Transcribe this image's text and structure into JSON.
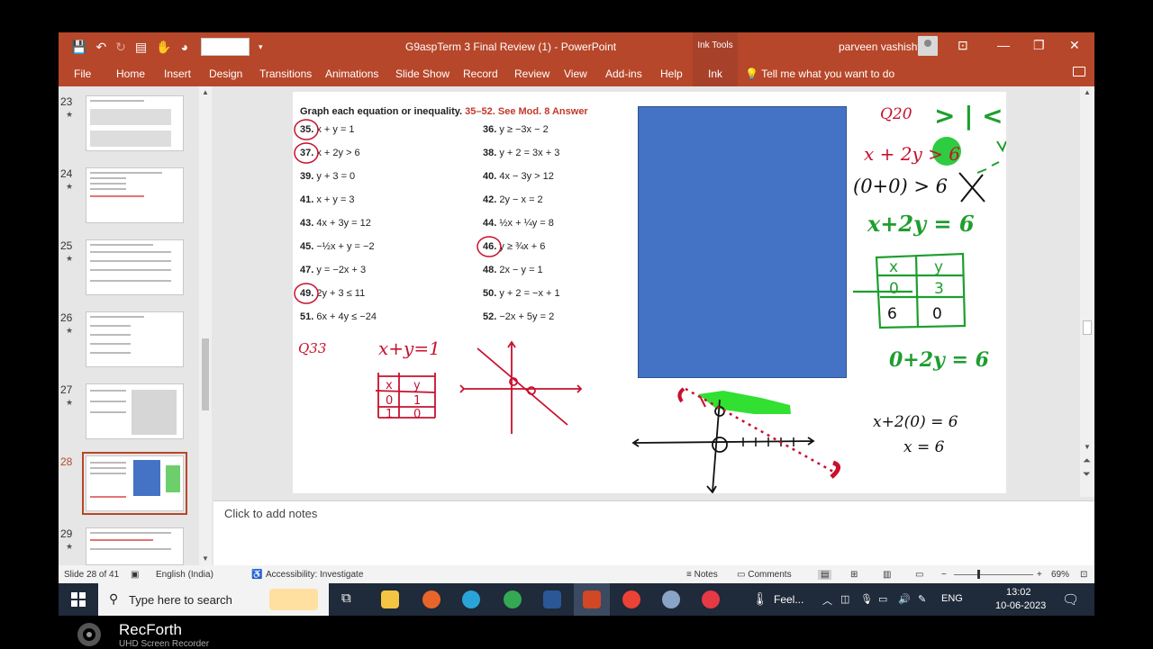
{
  "window": {
    "doc_title": "G9aspTerm 3 Final Review (1)  -  PowerPoint",
    "ink_tools_label": "Ink Tools",
    "user_name": "parveen vashisht",
    "tell_me": "Tell me what you want to do"
  },
  "ribbon": {
    "tabs": [
      "File",
      "Home",
      "Insert",
      "Design",
      "Transitions",
      "Animations",
      "Slide Show",
      "Record",
      "Review",
      "View",
      "Add-ins",
      "Help"
    ],
    "active_tab": "Ink"
  },
  "thumbnails": {
    "numbers": [
      "23",
      "24",
      "25",
      "26",
      "27",
      "28",
      "29"
    ],
    "selected": "28"
  },
  "slide": {
    "heading": "Graph each equation or inequality.",
    "heading_note": "35–52. See Mod. 8 Answer",
    "problems_left": [
      {
        "num": "35.",
        "eq": "x + y = 1"
      },
      {
        "num": "37.",
        "eq": "x + 2y > 6"
      },
      {
        "num": "39.",
        "eq": "y + 3 = 0"
      },
      {
        "num": "41.",
        "eq": "x + y = 3"
      },
      {
        "num": "43.",
        "eq": "4x + 3y = 12"
      },
      {
        "num": "45.",
        "eq": "−½x + y = −2"
      },
      {
        "num": "47.",
        "eq": "y = −2x + 3"
      },
      {
        "num": "49.",
        "eq": "2y + 3 ≤ 11"
      },
      {
        "num": "51.",
        "eq": "6x + 4y ≤ −24"
      }
    ],
    "problems_right": [
      {
        "num": "36.",
        "eq": "y ≥ −3x − 2"
      },
      {
        "num": "38.",
        "eq": "y + 2 = 3x + 3"
      },
      {
        "num": "40.",
        "eq": "4x − 3y > 12"
      },
      {
        "num": "42.",
        "eq": "2y − x = 2"
      },
      {
        "num": "44.",
        "eq": "½x + ¼y = 8"
      },
      {
        "num": "46.",
        "eq": "y ≥ ¾x + 6"
      },
      {
        "num": "48.",
        "eq": "2x − y = 1"
      },
      {
        "num": "50.",
        "eq": "y + 2 = −x + 1"
      },
      {
        "num": "52.",
        "eq": "−2x + 5y = 2"
      }
    ],
    "ink_red": {
      "q_label": "Q33",
      "equation": "x+y=1",
      "table_head": [
        "x",
        "y"
      ],
      "table_rows": [
        [
          "0",
          "1"
        ],
        [
          "1",
          "0"
        ]
      ]
    },
    "ink_green": {
      "q_label": "Q20",
      "symbols": "> | <",
      "ineq": "x + 2y > 6",
      "test": "(0+0) > 6",
      "equation": "x+2y = 6",
      "table_head": [
        "x",
        "y"
      ],
      "table_rows": [
        [
          "0",
          "3"
        ],
        [
          "6",
          "0"
        ]
      ],
      "work": "0+2y = 6"
    },
    "ink_black": {
      "line1": "x+2(0) = 6",
      "line2": "x = 6"
    }
  },
  "notes": {
    "placeholder": "Click to add notes"
  },
  "statusbar": {
    "slide_info": "Slide 28 of 41",
    "language": "English (India)",
    "accessibility": "Accessibility: Investigate",
    "notes_btn": "Notes",
    "comments_btn": "Comments",
    "zoom": "69%"
  },
  "taskbar": {
    "search_placeholder": "Type here to search",
    "weather": "Feel...",
    "lang": "ENG",
    "time": "13:02",
    "date": "10-06-2023"
  },
  "overlay": {
    "brand": "RecForth",
    "sub": "UHD Screen Recorder"
  }
}
